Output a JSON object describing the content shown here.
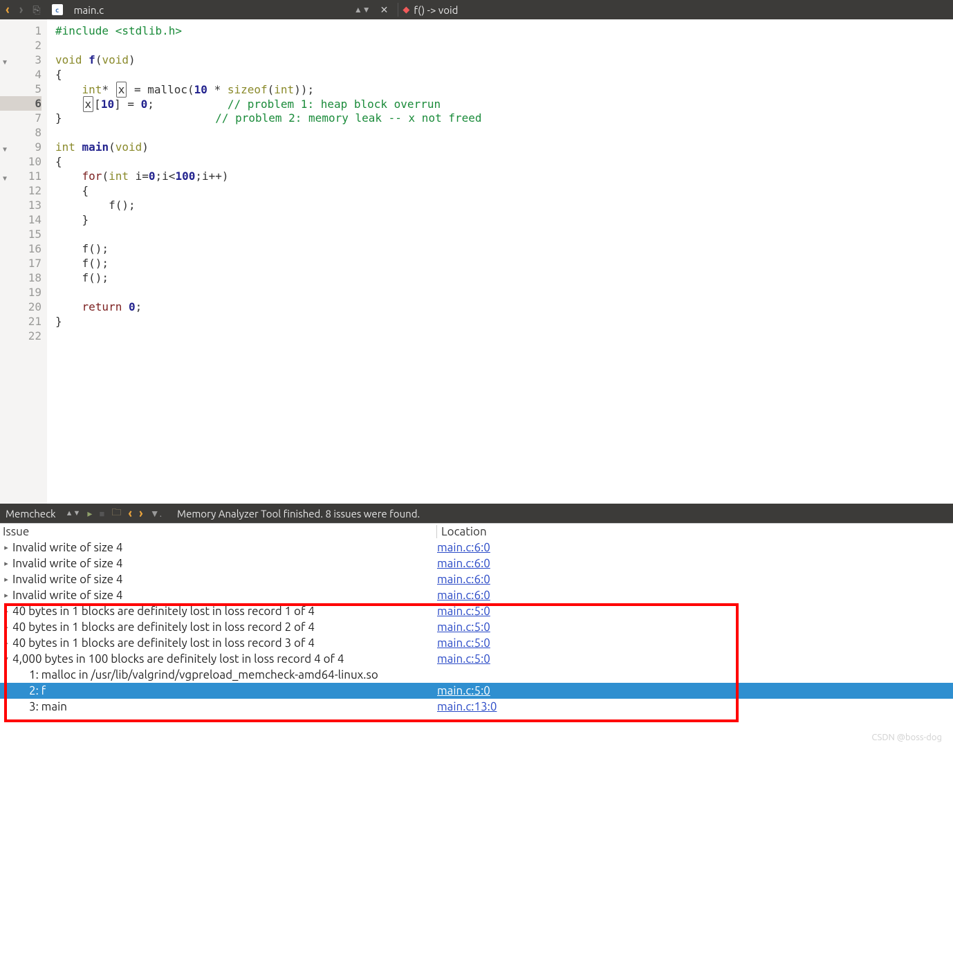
{
  "topbar": {
    "file_icon_label": "c",
    "filename": "main.c",
    "function_sig": "f() -> void"
  },
  "editor": {
    "lines": [
      {
        "n": 1,
        "html": "<span class='tok-green'>#include</span> <span class='tok-green'>&lt;stdlib.h&gt;</span>"
      },
      {
        "n": 2,
        "html": ""
      },
      {
        "n": 3,
        "fold": true,
        "html": "<span class='tok-olive'>void</span> <span class='tok-navy'>f</span>(<span class='tok-olive'>void</span>)"
      },
      {
        "n": 4,
        "html": "{"
      },
      {
        "n": 5,
        "html": "    <span class='tok-olive'>int</span>* <span class='box'>x</span> = malloc(<span class='tok-navy'>10</span> * <span class='tok-olive'>sizeof</span>(<span class='tok-olive'>int</span>));"
      },
      {
        "n": 6,
        "current": true,
        "mark": true,
        "html": "    <span class='box'>x</span>[<span class='tok-navy'>10</span>] = <span class='tok-navy'>0</span>;           <span class='tok-comment'>// problem 1: heap block overrun</span>"
      },
      {
        "n": 7,
        "html": "}                       <span class='tok-comment'>// problem 2: memory leak -- x not freed</span>"
      },
      {
        "n": 8,
        "html": ""
      },
      {
        "n": 9,
        "fold": true,
        "html": "<span class='tok-olive'>int</span> <span class='tok-navy'>main</span>(<span class='tok-olive'>void</span>)"
      },
      {
        "n": 10,
        "html": "{"
      },
      {
        "n": 11,
        "fold": true,
        "html": "    <span class='tok-maroon'>for</span>(<span class='tok-olive'>int</span> i=<span class='tok-navy'>0</span>;i&lt;<span class='tok-navy'>100</span>;i++)"
      },
      {
        "n": 12,
        "html": "    {"
      },
      {
        "n": 13,
        "html": "        f();"
      },
      {
        "n": 14,
        "html": "    }"
      },
      {
        "n": 15,
        "html": ""
      },
      {
        "n": 16,
        "html": "    f();"
      },
      {
        "n": 17,
        "html": "    f();"
      },
      {
        "n": 18,
        "html": "    f();"
      },
      {
        "n": 19,
        "html": ""
      },
      {
        "n": 20,
        "html": "    <span class='tok-maroon'>return</span> <span class='tok-navy'>0</span>;"
      },
      {
        "n": 21,
        "html": "}"
      },
      {
        "n": 22,
        "html": ""
      }
    ]
  },
  "bottombar": {
    "panel_title": "Memcheck",
    "status": "Memory Analyzer Tool finished. 8 issues were found."
  },
  "issue_header": {
    "col1": "Issue",
    "col2": "Location"
  },
  "issues": [
    {
      "tri": "▸",
      "indent": 0,
      "text": "Invalid write of size 4",
      "loc": "main.c:6:0"
    },
    {
      "tri": "▸",
      "indent": 0,
      "text": "Invalid write of size 4",
      "loc": "main.c:6:0"
    },
    {
      "tri": "▸",
      "indent": 0,
      "text": "Invalid write of size 4",
      "loc": "main.c:6:0"
    },
    {
      "tri": "▸",
      "indent": 0,
      "text": "Invalid write of size 4",
      "loc": "main.c:6:0"
    },
    {
      "tri": "▸",
      "indent": 0,
      "text": "40 bytes in 1 blocks are definitely lost in loss record 1 of 4",
      "loc": "main.c:5:0"
    },
    {
      "tri": "▸",
      "indent": 0,
      "text": "40 bytes in 1 blocks are definitely lost in loss record 2 of 4",
      "loc": "main.c:5:0"
    },
    {
      "tri": "▸",
      "indent": 0,
      "text": "40 bytes in 1 blocks are definitely lost in loss record 3 of 4",
      "loc": "main.c:5:0"
    },
    {
      "tri": "▾",
      "indent": 0,
      "text": "4,000 bytes in 100 blocks are definitely lost in loss record 4 of 4",
      "loc": "main.c:5:0"
    },
    {
      "tri": "",
      "indent": 1,
      "text": "1: malloc in /usr/lib/valgrind/vgpreload_memcheck-amd64-linux.so",
      "loc": ""
    },
    {
      "tri": "",
      "indent": 1,
      "text": "2: f",
      "loc": "main.c:5:0",
      "selected": true
    },
    {
      "tri": "",
      "indent": 1,
      "text": "3: main",
      "loc": "main.c:13:0"
    }
  ],
  "watermark": "CSDN @boss-dog"
}
